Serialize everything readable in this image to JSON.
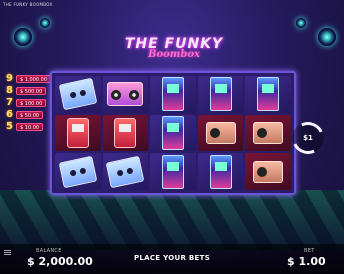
{
  "window": {
    "title": "THE FUNKY BOOMBOX"
  },
  "logo": {
    "main": "THE FUNKY",
    "sub": "Boombox"
  },
  "paytable": [
    {
      "count": "9",
      "value": "$ 1,000.00"
    },
    {
      "count": "8",
      "value": "$ 500.00"
    },
    {
      "count": "7",
      "value": "$ 100.00"
    },
    {
      "count": "6",
      "value": "$ 50.00"
    },
    {
      "count": "5",
      "value": "$ 10.00"
    }
  ],
  "spin": {
    "value": "$1"
  },
  "footer": {
    "balance_label": "BALANCE",
    "balance_value": "$ 2,000.00",
    "prompt": "PLACE YOUR BETS",
    "bet_label": "BET",
    "bet_value": "$ 1.00"
  },
  "reels": [
    [
      "cassette",
      "boombox",
      "arcade",
      "arcade",
      "arcade"
    ],
    [
      "walkman",
      "walkman",
      "arcade",
      "radio",
      "radio"
    ],
    [
      "cassette",
      "cassette",
      "arcade",
      "arcade",
      "radio"
    ]
  ],
  "icons": [
    "menu-icon",
    "spin-icon",
    "star-icon"
  ],
  "colors": {
    "accent": "#ff4fd8",
    "frame": "#6a55d8",
    "paytable_number": "#ffe16a"
  }
}
